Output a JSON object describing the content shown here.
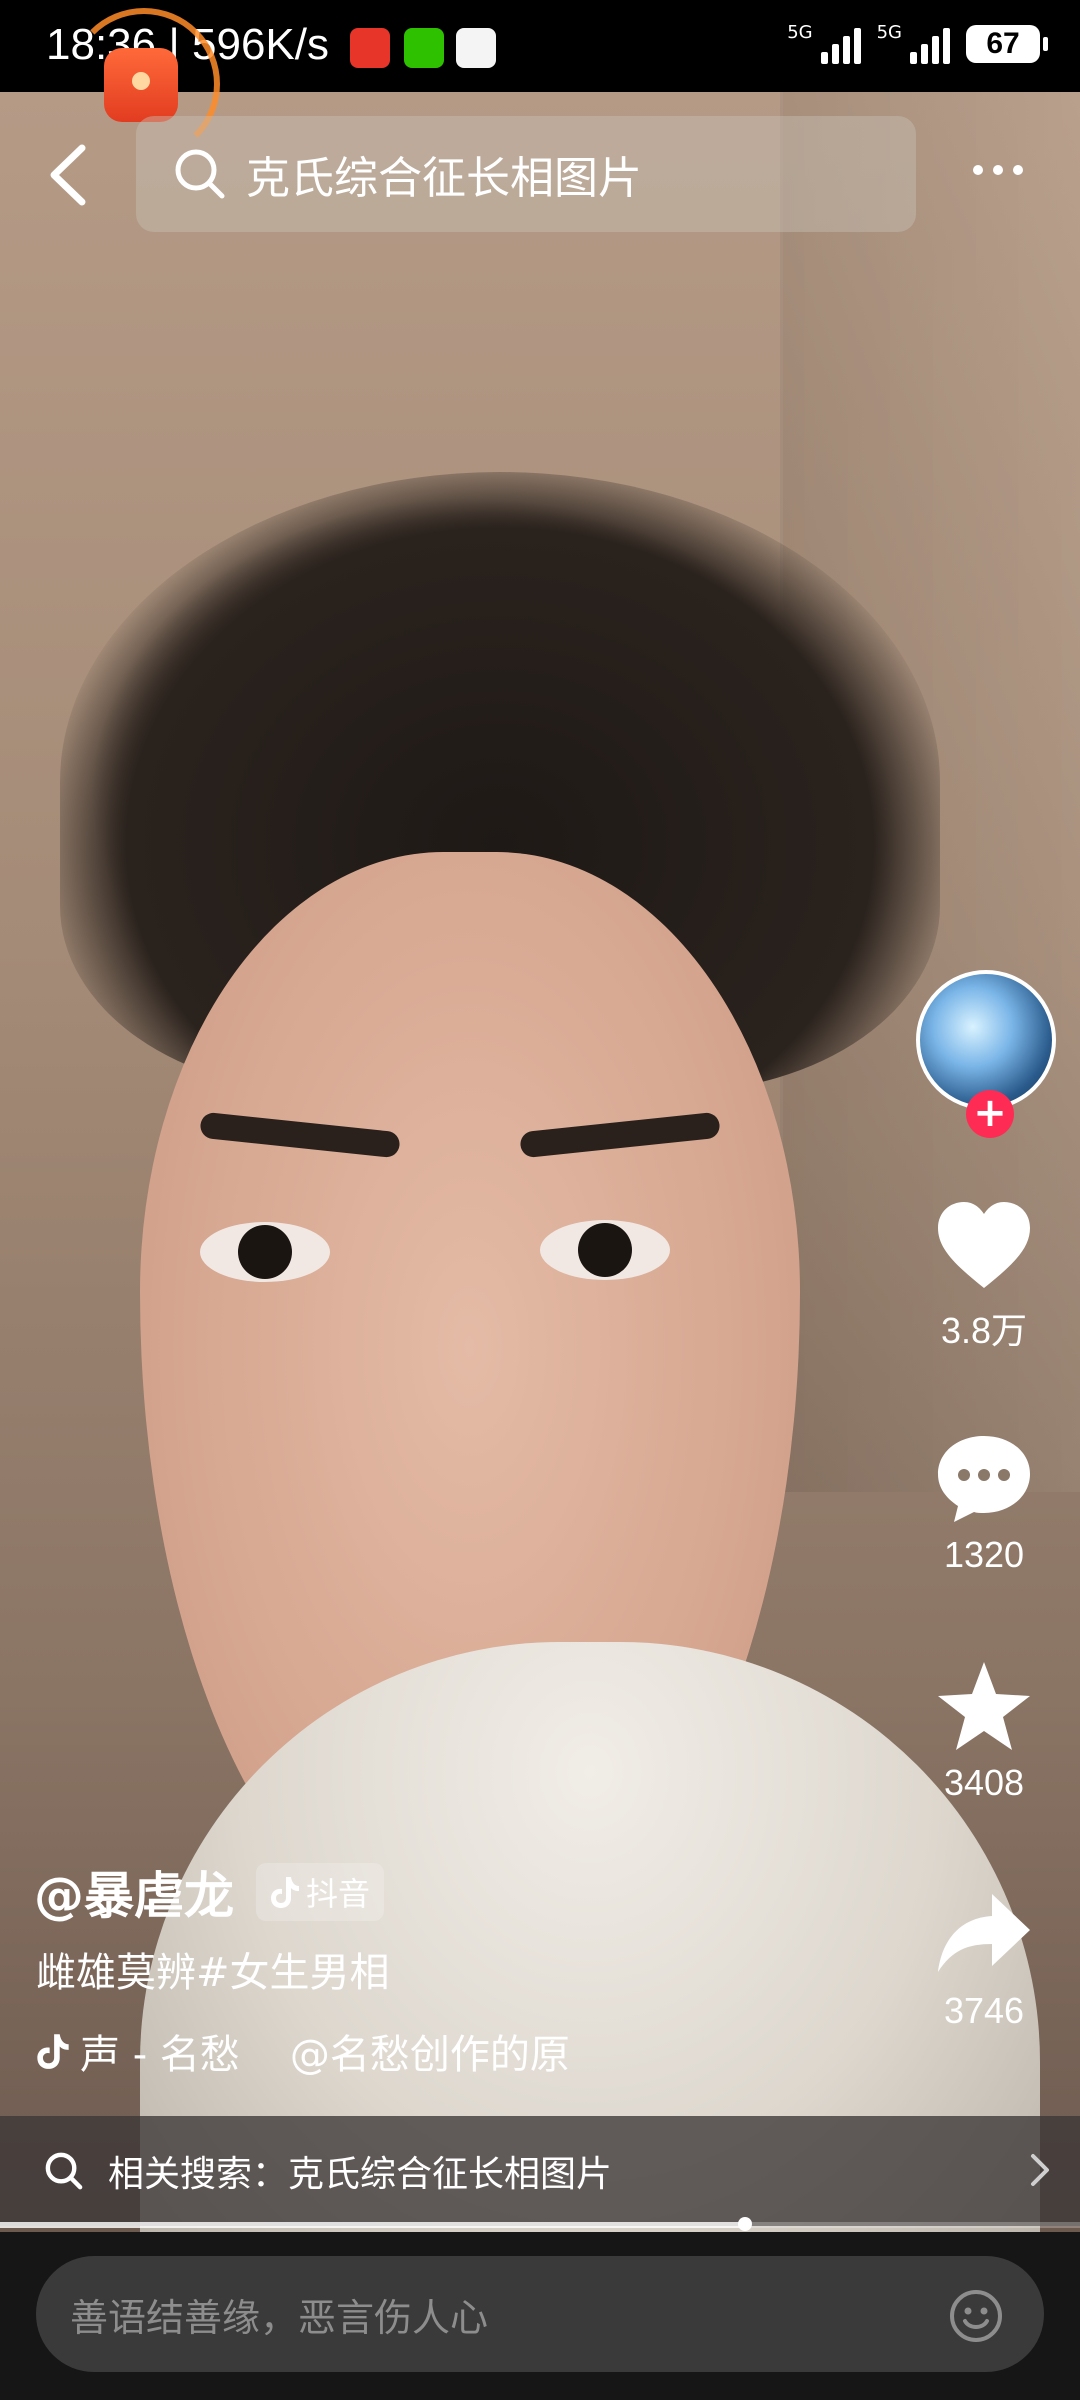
{
  "status_bar": {
    "time": "18:36",
    "speed": "596K/s",
    "signal_1": "5G",
    "signal_2": "5G",
    "battery": "67"
  },
  "search": {
    "query": "克氏综合征长相图片"
  },
  "actions": {
    "likes": "3.8万",
    "comments": "1320",
    "favorites": "3408",
    "shares": "3746"
  },
  "post": {
    "author": "@暴虐龙",
    "platform_badge": "抖音",
    "description": "雌雄莫辨#女生男相",
    "music_title": "声 - 名愁",
    "music_origin": "@名愁创作的原"
  },
  "related_search": {
    "label": "相关搜索：克氏综合征长相图片"
  },
  "progress": {
    "fraction": 0.69
  },
  "comment_box": {
    "placeholder": "善语结善缘，恶言伤人心"
  },
  "colors": {
    "accent": "#fe2c55",
    "status_bg": "#000000",
    "bottom_bg": "#161616"
  }
}
